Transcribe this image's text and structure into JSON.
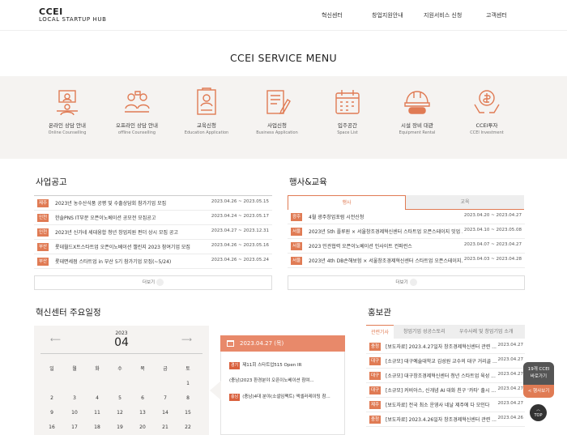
{
  "header": {
    "logo_line1": "CCEI",
    "logo_line2": "LOCAL STARTUP HUB",
    "nav": [
      "혁신센터",
      "창업지원안내",
      "지원서비스 신청",
      "고객센터"
    ]
  },
  "service_menu": {
    "title": "CCEI SERVICE MENU",
    "items": [
      {
        "ko": "온라인 상담 안내",
        "en": "Online Counselling",
        "icon": "online-counselling-icon"
      },
      {
        "ko": "오프라인 상담 안내",
        "en": "offline Counselling",
        "icon": "offline-counselling-icon"
      },
      {
        "ko": "교육신청",
        "en": "Education Application",
        "icon": "education-icon"
      },
      {
        "ko": "사업신청",
        "en": "Business Application",
        "icon": "business-icon"
      },
      {
        "ko": "입주공간",
        "en": "Space List",
        "icon": "calendar-icon"
      },
      {
        "ko": "시설 장비 대관",
        "en": "Equipment Rental",
        "icon": "helmet-icon"
      },
      {
        "ko": "CCEI투자",
        "en": "CCEI Investment",
        "icon": "investment-icon"
      }
    ]
  },
  "notices": {
    "title": "사업공고",
    "more": "더보기",
    "rows": [
      {
        "tag": "제주",
        "text": "2023년 농수산식품 공평 및 수출상담회 참가기업 모집",
        "date": "2023.04.26 ~ 2023.05.15"
      },
      {
        "tag": "인천",
        "text": "한솔PNS IT부문 오픈이노베이션 공모전 모집공고",
        "date": "2023.04.24 ~ 2023.05.17"
      },
      {
        "tag": "인천",
        "text": "2023년 신가네 세대융합 청년 창업지원 펀더 상시 모집 공고",
        "date": "2023.04.27 ~ 2023.12.31"
      },
      {
        "tag": "부산",
        "text": "롯데월드X트스타트업 오픈이노베이션 챌린지 2023 참여기업 모집",
        "date": "2023.04.26 ~ 2023.05.16"
      },
      {
        "tag": "부산",
        "text": "롯데면세점 스타트업 in 부산 5기 참가기업 모집(~5/24)",
        "date": "2023.04.26 ~ 2023.05.24"
      }
    ]
  },
  "events": {
    "title": "행사&교육",
    "tabs": [
      "행사",
      "교육"
    ],
    "more": "더보기",
    "rows": [
      {
        "tag": "광주",
        "text": "4월 광주창업포럼 시전신청",
        "date": "2023.04.20 ~ 2023.04.27"
      },
      {
        "tag": "서울",
        "text": "2023년 5th 플루원 × 서울창조경제혁신센터 스타트업 오픈스테이지 밋업 ...",
        "date": "2023.04.10 ~ 2023.05.08"
      },
      {
        "tag": "서울",
        "text": "2023 민관협력 오픈이노베이션 인사이트 컨퍼런스",
        "date": "2023.04.07 ~ 2023.04.27"
      },
      {
        "tag": "서울",
        "text": "2023년 4th DB손해보험 × 서울창조경제혁신센터 스타트업 오픈스테이지...",
        "date": "2023.04.03 ~ 2023.04.28"
      }
    ]
  },
  "calendar": {
    "title": "혁신센터 주요일정",
    "year": "2023",
    "month": "04",
    "weekdays": [
      "일",
      "월",
      "화",
      "수",
      "목",
      "금",
      "토"
    ],
    "rows": [
      [
        "",
        "",
        "",
        "",
        "",
        "",
        "1"
      ],
      [
        "2",
        "3",
        "4",
        "5",
        "6",
        "7",
        "8"
      ],
      [
        "9",
        "10",
        "11",
        "12",
        "13",
        "14",
        "15"
      ],
      [
        "16",
        "17",
        "18",
        "19",
        "20",
        "21",
        "22"
      ]
    ]
  },
  "schedule": {
    "date": "2023.04.27 (목)",
    "rows": [
      {
        "tag": "경기",
        "text": "제11회 스타트업515 Open IR"
      },
      {
        "tag": "",
        "text": "(충남)2023 환경분야 오픈이노베이션 참여..."
      },
      {
        "tag": "충남",
        "text": "(충남)4대 분야(소셜임팩트) 액셀러레이팅 참..."
      }
    ]
  },
  "pr": {
    "title": "홍보관",
    "tabs": [
      "관련기사",
      "창업기업 성공스토리",
      "우수사례 및 창업기업 소개"
    ],
    "rows": [
      {
        "tag": "충청",
        "text": "[보도자료] 2023.4.27일자 창조경제혁신센터 관련 ...",
        "date": "2023.04.27"
      },
      {
        "tag": "대구",
        "text": "[소규모] 대구예술대학교 김성원 교수의 대구 거리골 ...",
        "date": "2023.04.27"
      },
      {
        "tag": "대구",
        "text": "[소규모] 대구창조경제혁신센터 청년 스타트업 육성 ...",
        "date": "2023.04.27"
      },
      {
        "tag": "대구",
        "text": "[소규모] 커비아스, 신개념 AI 대화 친구 '카타' 출시 ...",
        "date": "2023.04.27"
      },
      {
        "tag": "제주",
        "text": "[보도자료] 전국 최소 운영사 네날 제주에 다 모인다",
        "date": "2023.04.27"
      },
      {
        "tag": "충청",
        "text": "[보도자료] 2023.4.26일자 창조경제혁신센터 관련 ...",
        "date": "2023.04.26"
      }
    ]
  },
  "floating": {
    "ccei_line1": "19개 CCEI",
    "ccei_line2": "바로가기",
    "sitemap": "< 행사보기",
    "top": "TOP"
  },
  "colors": {
    "accent": "#e07b54",
    "band": "#f5f3f1",
    "tag_red": "#d9613e"
  }
}
